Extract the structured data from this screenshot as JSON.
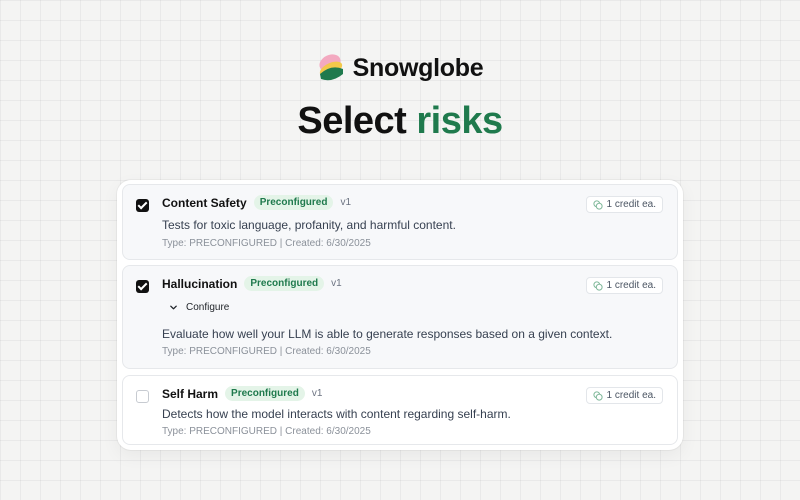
{
  "brand": {
    "name": "Snowglobe",
    "colors": {
      "pink": "#f3a9c0",
      "yellow": "#f2c84b",
      "green": "#1f7a4d"
    }
  },
  "headline": {
    "prefix": "Select",
    "accent": "risks",
    "accent_color": "#1f7a4d"
  },
  "risks": [
    {
      "checked": true,
      "title": "Content Safety",
      "badge": "Preconfigured",
      "version": "v1",
      "credit": "1 credit ea.",
      "description": "Tests for toxic language, profanity, and harmful content.",
      "meta": "Type: PRECONFIGURED | Created: 6/30/2025"
    },
    {
      "checked": true,
      "title": "Hallucination",
      "badge": "Preconfigured",
      "version": "v1",
      "credit": "1 credit ea.",
      "configure_label": "Configure",
      "description": "Evaluate how well your LLM is able to generate responses based on a given context.",
      "meta": "Type: PRECONFIGURED | Created: 6/30/2025"
    },
    {
      "checked": false,
      "title": "Self Harm",
      "badge": "Preconfigured",
      "version": "v1",
      "credit": "1 credit ea.",
      "description": "Detects how the model interacts with content regarding self-harm.",
      "meta": "Type: PRECONFIGURED | Created: 6/30/2025"
    }
  ],
  "icons": {
    "credit": "coins-icon",
    "configure": "chevron-down-icon",
    "logo": "snowglobe-logo-icon"
  }
}
